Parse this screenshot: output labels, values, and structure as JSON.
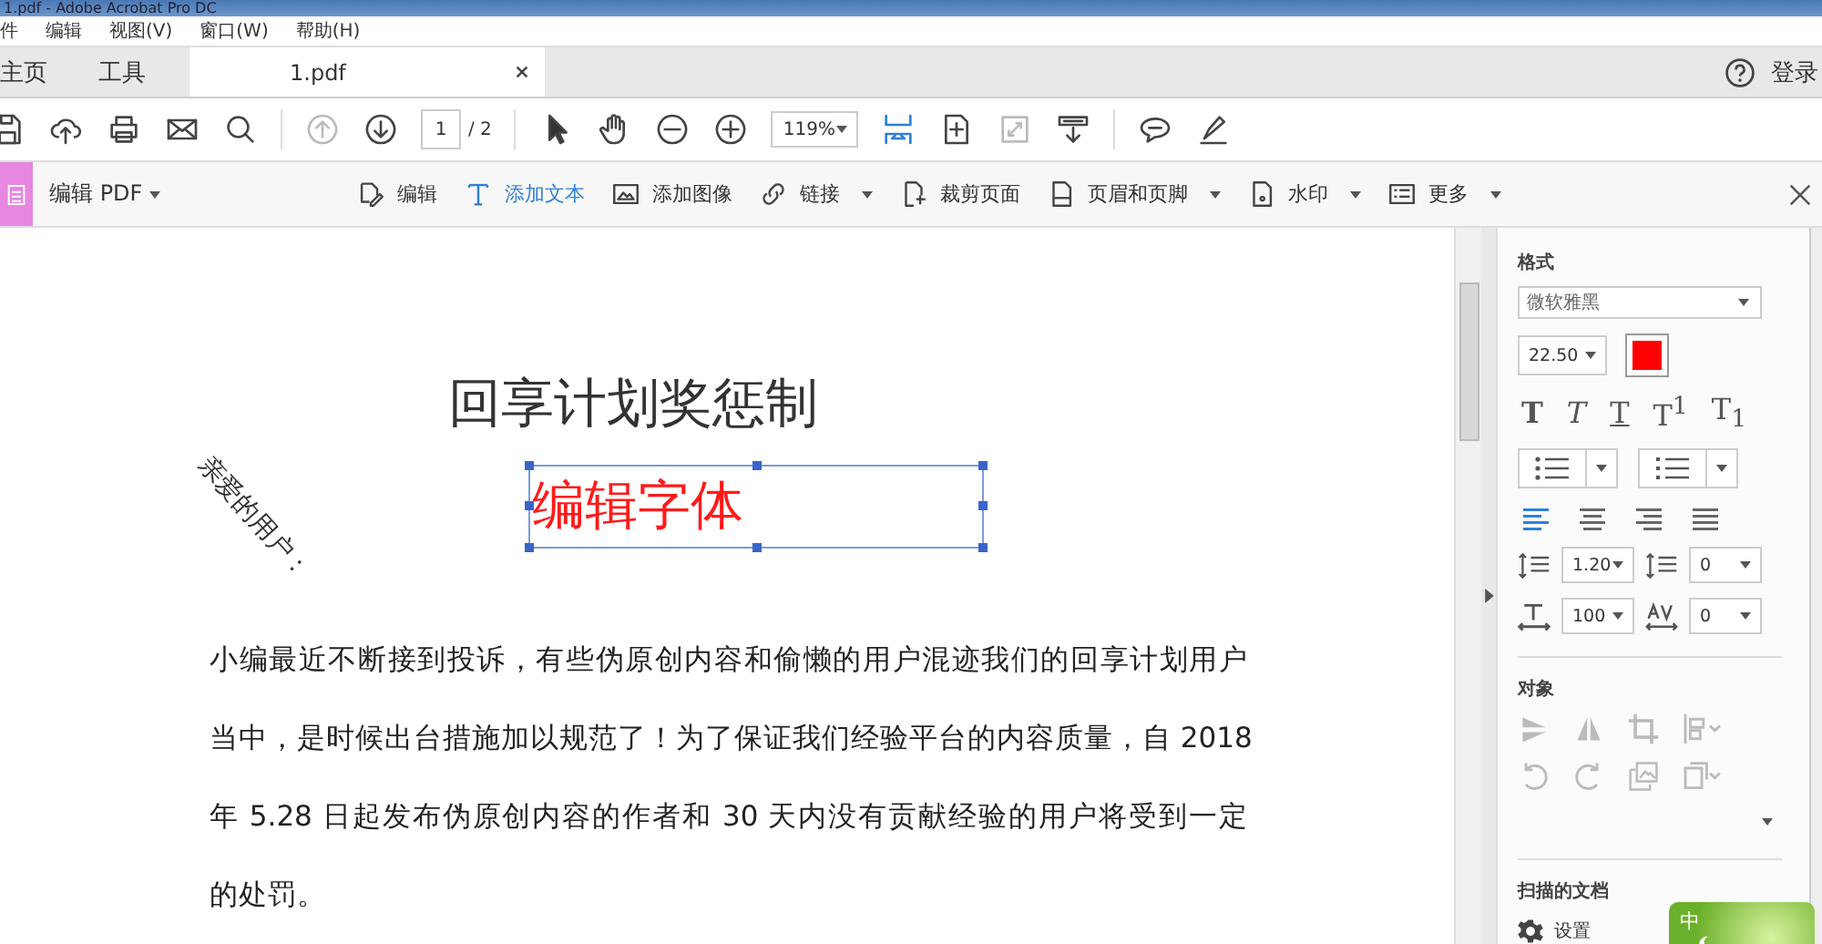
{
  "window": {
    "title": "1.pdf - Adobe Acrobat Pro DC"
  },
  "menu": [
    "件",
    "编辑",
    "视图(V)",
    "窗口(W)",
    "帮助(H)"
  ],
  "nav_tabs": [
    {
      "label": "主页",
      "selected": false
    },
    {
      "label": "工具",
      "selected": false
    },
    {
      "label": "1.pdf",
      "selected": true,
      "closable": true
    }
  ],
  "account": {
    "login": "登录"
  },
  "toolbar": {
    "page": "1",
    "page_total": "/ 2",
    "zoom": "119%",
    "left_tools": [
      {
        "kind": "save",
        "disabled": false
      },
      {
        "kind": "upload",
        "disabled": false
      },
      {
        "kind": "print",
        "disabled": false
      },
      {
        "kind": "mail",
        "disabled": false
      },
      {
        "kind": "search",
        "disabled": false
      }
    ],
    "nav_tools": [
      {
        "kind": "up",
        "disabled": true
      },
      {
        "kind": "down",
        "disabled": false
      }
    ],
    "view_tools": [
      {
        "kind": "pointer",
        "disabled": false
      },
      {
        "kind": "hand",
        "disabled": false
      },
      {
        "kind": "zoomout",
        "disabled": false
      },
      {
        "kind": "zoomin",
        "disabled": false
      }
    ],
    "fit_tools": [
      {
        "kind": "fitwidth",
        "disabled": false,
        "selected": true
      },
      {
        "kind": "fitpage",
        "disabled": false,
        "selected": false
      },
      {
        "kind": "fullscreen",
        "disabled": true,
        "selected": false
      },
      {
        "kind": "scrollmode",
        "disabled": false,
        "selected": false
      }
    ],
    "comment_tools": [
      {
        "kind": "comment",
        "disabled": false
      },
      {
        "kind": "pen",
        "disabled": false
      }
    ]
  },
  "edit_toolbar": {
    "title": "编辑 PDF",
    "tools": [
      {
        "label": "编辑",
        "kind": "edit",
        "selected": false,
        "dropdown": false
      },
      {
        "label": "添加文本",
        "kind": "text",
        "selected": true,
        "dropdown": false
      },
      {
        "label": "添加图像",
        "kind": "image",
        "selected": false,
        "dropdown": false
      },
      {
        "label": "链接",
        "kind": "link",
        "selected": false,
        "dropdown": true
      },
      {
        "label": "裁剪页面",
        "kind": "crop",
        "selected": false,
        "dropdown": false
      },
      {
        "label": "页眉和页脚",
        "kind": "page",
        "selected": false,
        "dropdown": true
      },
      {
        "label": "水印",
        "kind": "watermark",
        "selected": false,
        "dropdown": true
      },
      {
        "label": "更多",
        "kind": "more",
        "selected": false,
        "dropdown": true
      }
    ]
  },
  "document": {
    "greeting": "亲爱的用户：",
    "heading": "回享计划奖惩制",
    "edit_box": "编辑字体",
    "lines": [
      "小编最近不断接到投诉，有些伪原创内容和偷懒的用户混迹我们的回享计划用户",
      "当中，是时候出台措施加以规范了！为了保证我们经验平台的内容质量，自 2018",
      "年 5.28 日起发布伪原创内容的作者和 30 天内没有贡献经验的用户将受到一定",
      "的处罚。"
    ]
  },
  "format_panel": {
    "title": "格式",
    "font": "微软雅黑",
    "size": "22.50",
    "color": "#ff0000",
    "text_styles": [
      {
        "label": "T",
        "kind": "bold"
      },
      {
        "label": "T",
        "kind": "italic"
      },
      {
        "label": "T",
        "kind": "underline"
      },
      {
        "label": "T$^{1}$",
        "kind": "plain"
      },
      {
        "label": "T$_{1}$",
        "kind": "plain"
      }
    ],
    "alignments": [
      {
        "kind": "left",
        "selected": true
      },
      {
        "kind": "center",
        "selected": false
      },
      {
        "kind": "right",
        "selected": false
      },
      {
        "kind": "justify",
        "selected": false
      }
    ],
    "line_spacing": "1.20",
    "paragraph_spacing": "0",
    "scale": "100",
    "tracking": "0"
  },
  "object_panel": {
    "title": "对象"
  },
  "scan_panel": {
    "title": "扫描的文档",
    "settings": "设置"
  },
  "ime": {
    "label": "中"
  }
}
